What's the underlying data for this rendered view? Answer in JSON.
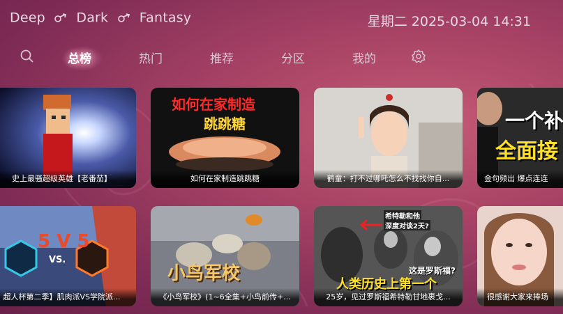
{
  "header": {
    "parts": [
      "Deep",
      "Dark",
      "Fantasy"
    ],
    "datetime": "星期二 2025-03-04 14:31"
  },
  "nav": {
    "tabs": [
      {
        "label": "总榜",
        "active": true
      },
      {
        "label": "热门",
        "active": false
      },
      {
        "label": "推荐",
        "active": false
      },
      {
        "label": "分区",
        "active": false
      },
      {
        "label": "我的",
        "active": false
      }
    ],
    "left_icon": "search-icon",
    "right_icon": "gear-icon"
  },
  "videos": [
    {
      "caption": "史上最骚超级英雄【老番茄】",
      "overlay": []
    },
    {
      "caption": "如何在家制造跳跳糖",
      "overlay": [
        "如何在家制造",
        "跳跳糖"
      ]
    },
    {
      "caption": "鹤童：打不过哪吒怎么不找找你自...",
      "overlay": []
    },
    {
      "caption": "金句频出 爆点连连",
      "overlay": [
        "一个补",
        "全面接"
      ]
    },
    {
      "caption": "超人杯第二季】肌肉派VS学院派...",
      "overlay": [
        "5 V 5",
        "VS."
      ]
    },
    {
      "caption": "《小鸟军校》(1~6全集+小鸟前传+...",
      "overlay": [
        "小鸟军校"
      ]
    },
    {
      "caption": "25岁，见过罗斯福希特勒甘地裹戈...",
      "overlay": [
        "希特勒和他",
        "深度对谈2天?",
        "这是罗斯福?",
        "人类历史上第一个"
      ]
    },
    {
      "caption": "很感谢大家来捧场",
      "overlay": []
    }
  ],
  "colors": {
    "accent": "#ffb3d0",
    "background": "#9b3a62"
  }
}
